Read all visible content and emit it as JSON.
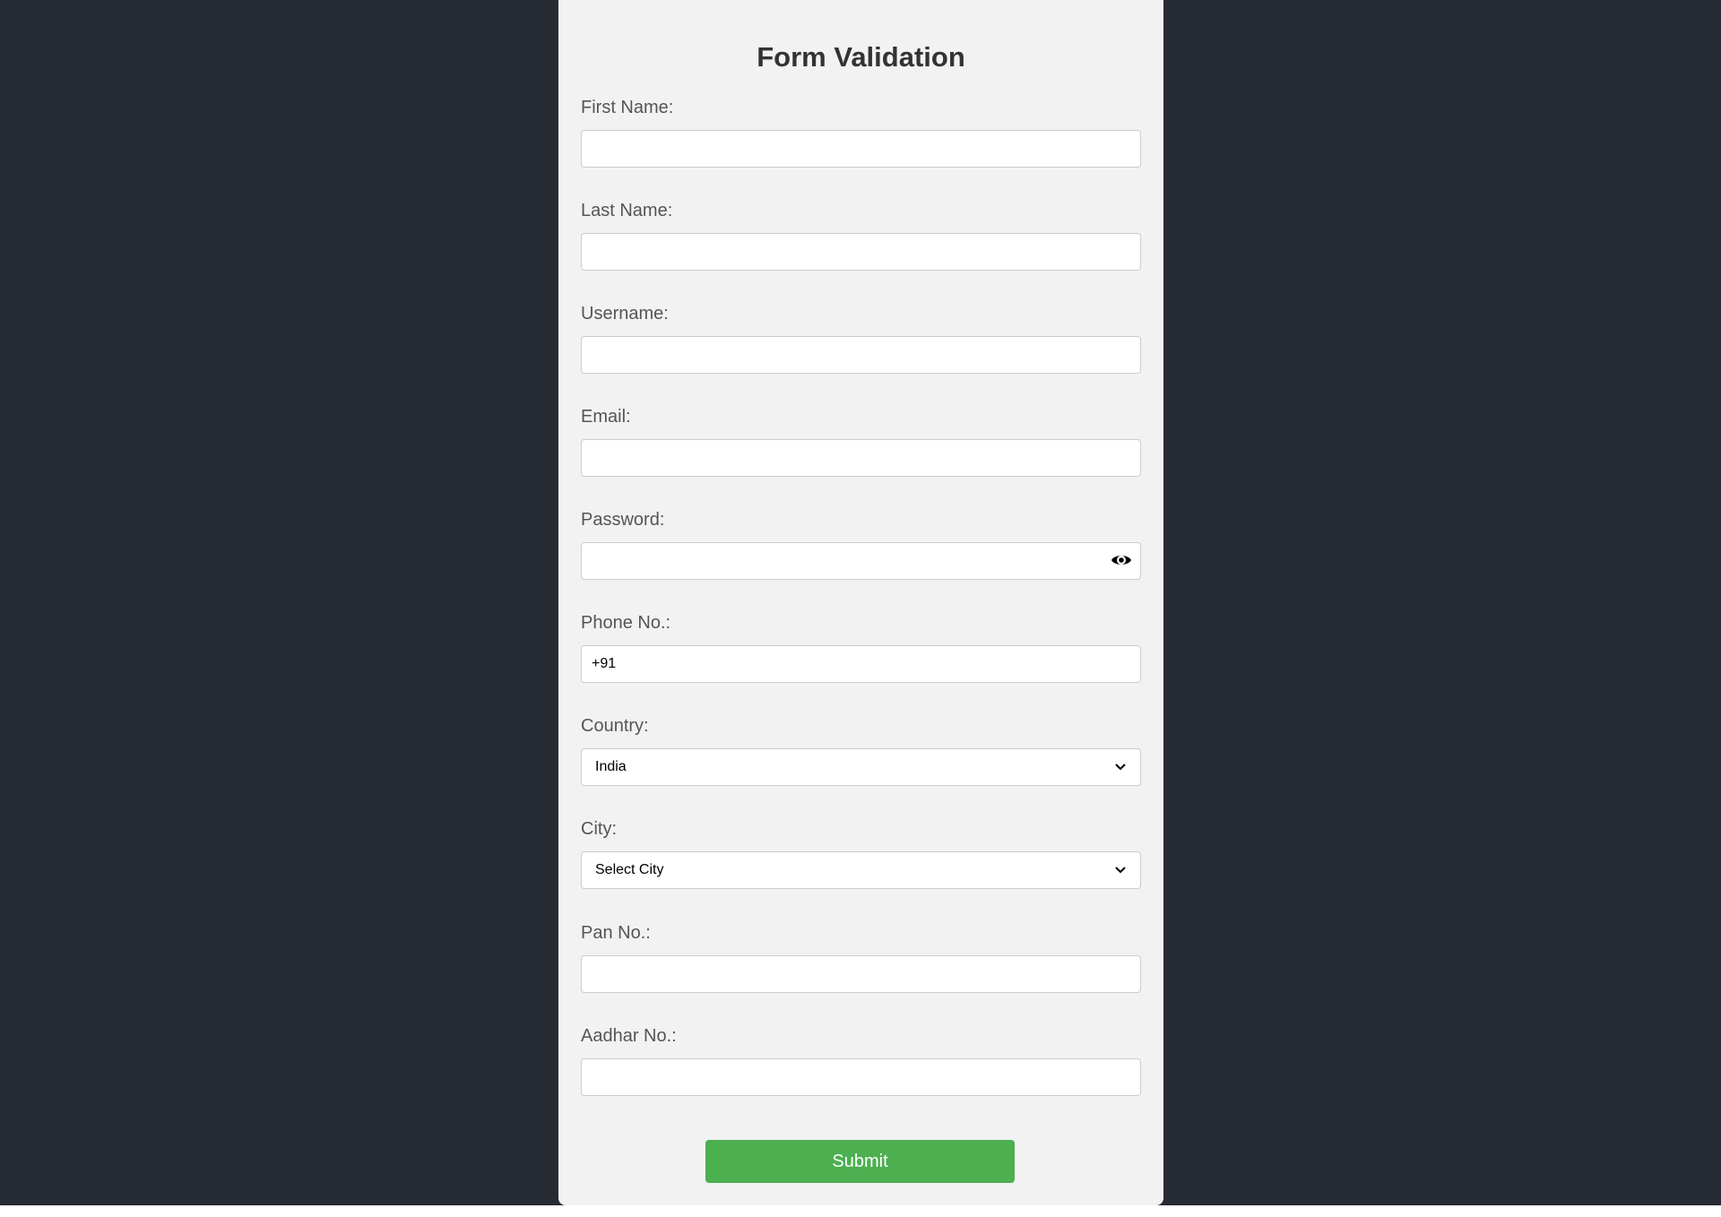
{
  "form": {
    "title": "Form Validation",
    "fields": [
      {
        "label": "First Name:",
        "value": "",
        "placeholder": ""
      },
      {
        "label": "Last Name:",
        "value": "",
        "placeholder": ""
      },
      {
        "label": "Username:",
        "value": "",
        "placeholder": ""
      },
      {
        "label": "Email:",
        "value": "",
        "placeholder": ""
      },
      {
        "label": "Password:",
        "value": "",
        "placeholder": "",
        "icon": "eye-icon"
      },
      {
        "label": "Phone No.:",
        "value": "+91",
        "placeholder": ""
      },
      {
        "label": "Country:",
        "selected": "India",
        "icon": "chevron-down-icon"
      },
      {
        "label": "City:",
        "selected": "Select City",
        "icon": "chevron-down-icon"
      },
      {
        "label": "Pan No.:",
        "value": "",
        "placeholder": ""
      },
      {
        "label": "Aadhar No.:",
        "value": "",
        "placeholder": ""
      }
    ],
    "submit_label": "Submit"
  },
  "colors": {
    "page_background": "#272b34",
    "card_background": "#f2f2f2",
    "submit_button": "#4caf50"
  }
}
